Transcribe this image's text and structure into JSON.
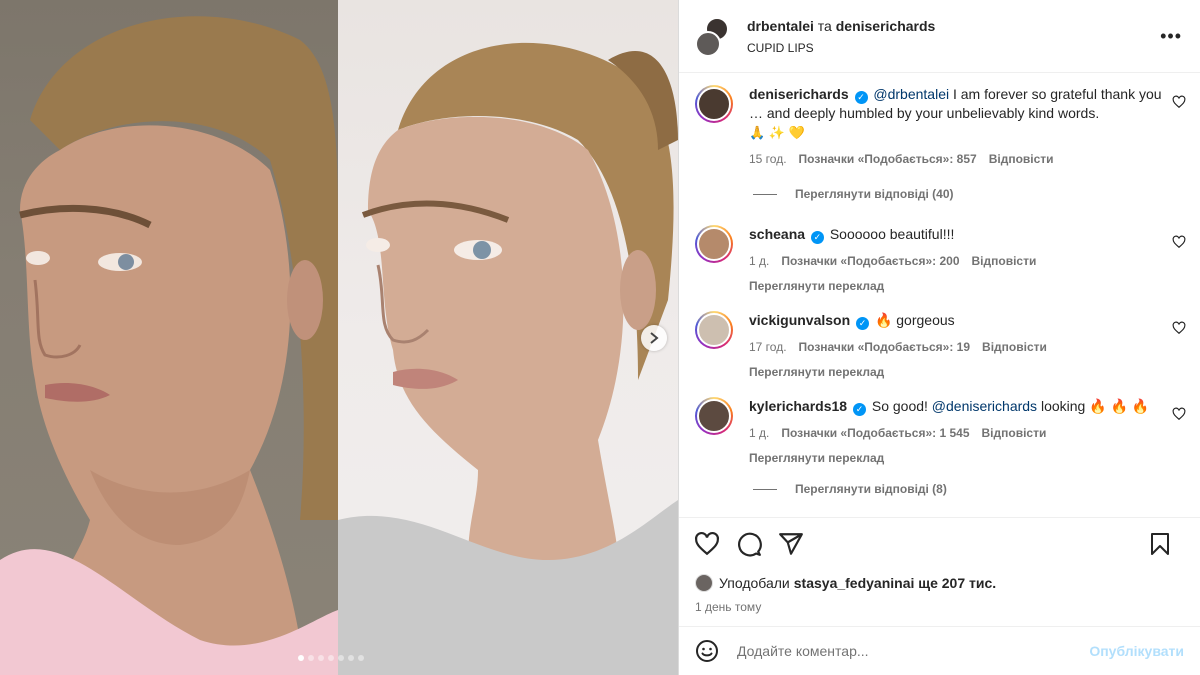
{
  "header": {
    "user1": "drbentalei",
    "conjunction": "та",
    "user2": "deniserichards",
    "subtitle": "CUPID LIPS",
    "more": "•••"
  },
  "comments": [
    {
      "username": "deniserichards",
      "mention": "@drbentalei",
      "text": " I am forever so grateful thank you … and deeply humbled by your unbelievably kind words.",
      "emoji": "🙏 ✨ 💛",
      "time": "15 год.",
      "likes": "Позначки «Подобається»: 857",
      "reply": "Відповісти",
      "view_replies": "Переглянути відповіді (40)"
    },
    {
      "username": "scheana",
      "text": "Soooooo beautiful!!!",
      "time": "1 д.",
      "likes": "Позначки «Подобається»: 200",
      "reply": "Відповісти",
      "translate": "Переглянути переклад"
    },
    {
      "username": "vickigunvalson",
      "text": "🔥 gorgeous",
      "time": "17 год.",
      "likes": "Позначки «Подобається»: 19",
      "reply": "Відповісти",
      "translate": "Переглянути переклад"
    },
    {
      "username": "kylerichards18",
      "text_before": "So good! ",
      "mention": "@deniserichards",
      "text_after": " looking 🔥 🔥 🔥",
      "time": "1 д.",
      "likes": "Позначки «Подобається»: 1 545",
      "reply": "Відповісти",
      "translate": "Переглянути переклад",
      "view_replies": "Переглянути відповіді (8)"
    }
  ],
  "likes_line": {
    "prefix": "Уподобали ",
    "user": "stasya_fedyanina",
    "suffix": " і ще 207 тис."
  },
  "time_ago": "1 день тому",
  "comment_box": {
    "placeholder": "Додайте коментар...",
    "publish": "Опублікувати"
  },
  "carousel": {
    "slides": 7,
    "active_index": 0
  },
  "colors": {
    "link": "#00376b",
    "verified": "#0095f6",
    "publish": "#b2dffc",
    "muted": "#737373"
  }
}
